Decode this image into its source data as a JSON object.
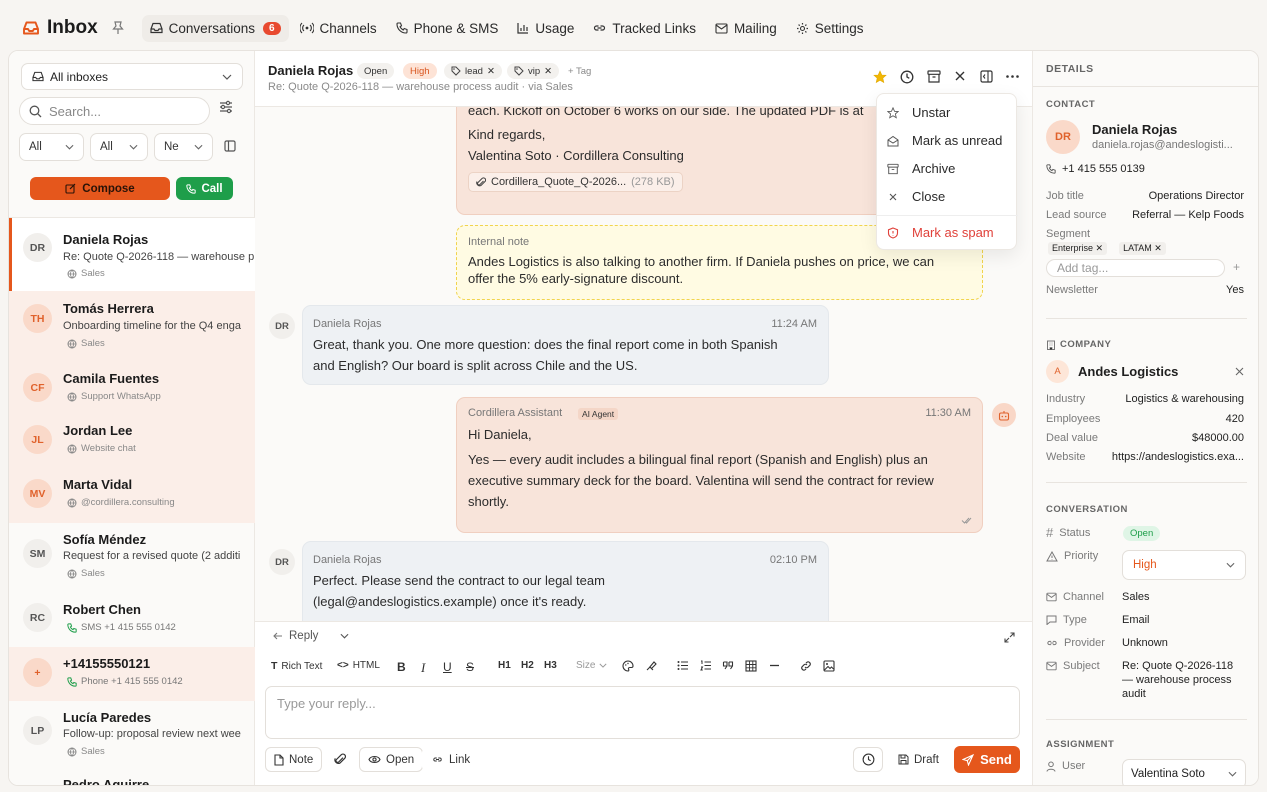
{
  "brand": {
    "title": "Inbox"
  },
  "nav": {
    "conversations": "Conversations",
    "conversations_badge": "6",
    "channels": "Channels",
    "phone": "Phone & SMS",
    "usage": "Usage",
    "tracked": "Tracked Links",
    "mailing": "Mailing",
    "settings": "Settings"
  },
  "left": {
    "inbox_select": "All inboxes",
    "search_placeholder": "Search...",
    "filters": [
      "All",
      "All",
      "Ne"
    ],
    "compose": "Compose",
    "call": "Call",
    "conversations": [
      {
        "initials": "DR",
        "name": "Daniela Rojas",
        "subject": "Re: Quote Q-2026-118 — warehouse p",
        "tag": "Sales"
      },
      {
        "initials": "TH",
        "name": "Tomás Herrera",
        "subject": "Onboarding timeline for the Q4 enga",
        "tag": "Sales"
      },
      {
        "initials": "CF",
        "name": "Camila Fuentes",
        "tag": "Support WhatsApp"
      },
      {
        "initials": "JL",
        "name": "Jordan Lee",
        "tag": "Website chat"
      },
      {
        "initials": "MV",
        "name": "Marta Vidal",
        "tag": "@cordillera.consulting"
      },
      {
        "initials": "SM",
        "name": "Sofía Méndez",
        "subject": "Request for a revised quote (2 additi",
        "tag": "Sales"
      },
      {
        "initials": "RC",
        "name": "Robert Chen",
        "tag": "SMS +1 415 555 0142"
      },
      {
        "initials": "+",
        "name": "+14155550121",
        "tag": "Phone +1 415 555 0142"
      },
      {
        "initials": "LP",
        "name": "Lucía Paredes",
        "subject": "Follow-up: proposal review next wee",
        "tag": "Sales"
      },
      {
        "initials": "",
        "name": "Pedro Aguirre",
        "tag": ""
      }
    ]
  },
  "header": {
    "name": "Daniela Rojas",
    "status": "Open",
    "priority": "High",
    "tags": [
      "lead",
      "vip"
    ],
    "add_tag": "+ Tag",
    "subject": "Re: Quote Q-2026-118 — warehouse process audit",
    "via": "via Sales"
  },
  "messages": {
    "m0_line1": "each. Kickoff on October 6 works on our side. The updated PDF is at",
    "m0_line2": "Kind regards,",
    "m0_line3": "Valentina Soto · Cordillera Consulting",
    "m0_attach": "Cordillera_Quote_Q-2026...",
    "m0_attach_size": "(278 KB)",
    "note_label": "Internal note",
    "note_line1": "Andes Logistics is also talking to another firm. If Daniela pushes on price, we can",
    "note_line2": "offer the 5% early-signature discount.",
    "m1_avatar": "DR",
    "m1_sender": "Daniela Rojas",
    "m1_time": "11:24 AM",
    "m1_line1": "Great, thank you. One more question: does the final report come in both Spanish",
    "m1_line2": "and English? Our board is split across Chile and the US.",
    "m2_sender": "Cordillera Assistant",
    "m2_badge": "AI Agent",
    "m2_time": "11:30 AM",
    "m2_line1": "Hi Daniela,",
    "m2_line2": "Yes — every audit includes a bilingual final report (Spanish and English) plus an",
    "m2_line3": "executive summary deck for the board. Valentina will send the contract for review",
    "m2_line4": "shortly.",
    "m3_avatar": "DR",
    "m3_sender": "Daniela Rojas",
    "m3_time": "02:10 PM",
    "m3_line1": "Perfect. Please send the contract to our legal team",
    "m3_line2": "(legal@andeslogistics.example) once it's ready."
  },
  "composer": {
    "mode": "Reply",
    "rich": "Rich Text",
    "html": "HTML",
    "h1": "H1",
    "h2": "H2",
    "h3": "H3",
    "size": "Size",
    "placeholder": "Type your reply...",
    "note": "Note",
    "open": "Open",
    "link": "Link",
    "draft": "Draft",
    "send": "Send"
  },
  "menu": {
    "unstar": "Unstar",
    "unread": "Mark as unread",
    "archive": "Archive",
    "close": "Close",
    "spam": "Mark as spam"
  },
  "details": {
    "title": "DETAILS",
    "contact_label": "CONTACT",
    "contact_initials": "DR",
    "contact_name": "Daniela Rojas",
    "contact_email": "daniela.rojas@andeslogisti...",
    "phone": "+1 415 555 0139",
    "job_label": "Job title",
    "job": "Operations Director",
    "source_label": "Lead source",
    "source": "Referral — Kelp Foods",
    "segment_label": "Segment",
    "segments": [
      "Enterprise",
      "LATAM"
    ],
    "add_tag": "Add tag...",
    "newsletter_label": "Newsletter",
    "newsletter": "Yes",
    "company_label": "COMPANY",
    "company_initial": "A",
    "company_name": "Andes Logistics",
    "industry_label": "Industry",
    "industry": "Logistics & warehousing",
    "employees_label": "Employees",
    "employees": "420",
    "deal_label": "Deal value",
    "deal": "$48000.00",
    "website_label": "Website",
    "website": "https://andeslogistics.exa...",
    "conv_label": "CONVERSATION",
    "status_label": "Status",
    "status": "Open",
    "priority_label": "Priority",
    "priority": "High",
    "channel_label": "Channel",
    "channel": "Sales",
    "type_label": "Type",
    "type": "Email",
    "provider_label": "Provider",
    "provider": "Unknown",
    "subject_label": "Subject",
    "subject1": "Re: Quote Q-2026-118",
    "subject2": "— warehouse process",
    "subject3": "audit",
    "assign_label": "ASSIGNMENT",
    "user_label": "User",
    "user": "Valentina Soto"
  },
  "colors": {
    "accent": "#e5571c",
    "green": "#1e9e4a",
    "star": "#f2b705",
    "spam": "#e0413a"
  }
}
